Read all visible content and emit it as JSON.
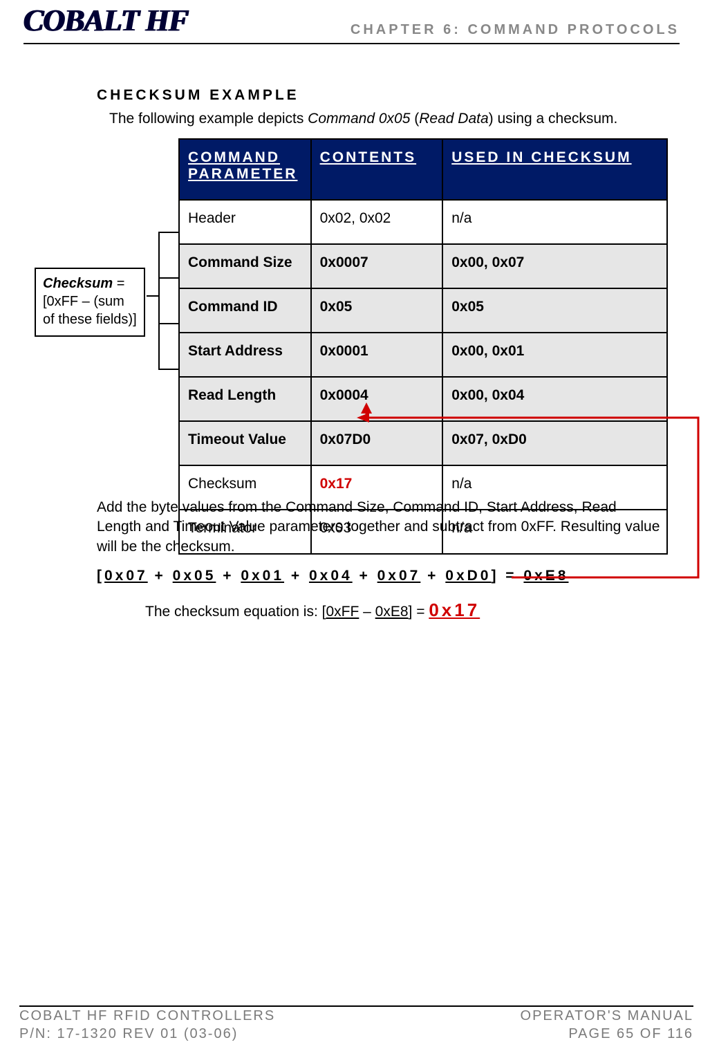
{
  "header": {
    "logo": "COBALT HF",
    "chapter": "CHAPTER 6: COMMAND PROTOCOLS"
  },
  "section": {
    "heading": "CHECKSUM EXAMPLE",
    "intro_prefix": "The following example depicts ",
    "intro_cmd": "Command 0x05",
    "intro_paren": " (",
    "intro_read": "Read Data",
    "intro_suffix": ") using a checksum."
  },
  "table": {
    "headers": {
      "c1": "COMMAND PARAMETER",
      "c2": "CONTENTS",
      "c3": "USED IN CHECKSUM"
    },
    "rows": [
      {
        "shaded": false,
        "p": "Header",
        "c": "0x02, 0x02",
        "u": "n/a"
      },
      {
        "shaded": true,
        "p": "Command Size",
        "c": "0x0007",
        "u": "0x00, 0x07"
      },
      {
        "shaded": true,
        "p": "Command ID",
        "c": "0x05",
        "u": "0x05"
      },
      {
        "shaded": true,
        "p": "Start Address",
        "c": "0x0001",
        "u": "0x00, 0x01"
      },
      {
        "shaded": true,
        "p": "Read Length",
        "c": "0x0004",
        "u": "0x00, 0x04"
      },
      {
        "shaded": true,
        "p": "Timeout Value",
        "c": "0x07D0",
        "u": "0x07, 0xD0"
      },
      {
        "shaded": false,
        "p": "Checksum",
        "c": "0x17",
        "u": "n/a",
        "checksum_highlight": true
      },
      {
        "shaded": false,
        "p": "Terminator",
        "c": "0x03",
        "u": "n/a"
      }
    ]
  },
  "callout": {
    "em": "Checksum",
    "eq": " = [0xFF – (sum of these fields)]"
  },
  "below": {
    "para": "Add the byte values from the Command Size, Command ID, Start Address, Read Length and Timeout Value parameters together and subtract from 0xFF. Resulting value will be the checksum.",
    "eq_parts": [
      "[",
      "0x07",
      " + ",
      "0x05",
      " + ",
      "0x01",
      " + ",
      "0x04",
      " + ",
      "0x07",
      " + ",
      "0xD0",
      "] = ",
      "0xE8"
    ],
    "eq2_prefix": "The checksum equation is: [",
    "eq2_a": "0xFF",
    "eq2_mid": " – ",
    "eq2_b": "0xE8",
    "eq2_suffix": "] = ",
    "eq2_result": "0x17"
  },
  "footer": {
    "left1": "COBALT HF RFID CONTROLLERS",
    "left2": "P/N: 17-1320 REV 01 (03-06)",
    "right1": "OPERATOR'S MANUAL",
    "right2": "PAGE 65 OF 116"
  }
}
